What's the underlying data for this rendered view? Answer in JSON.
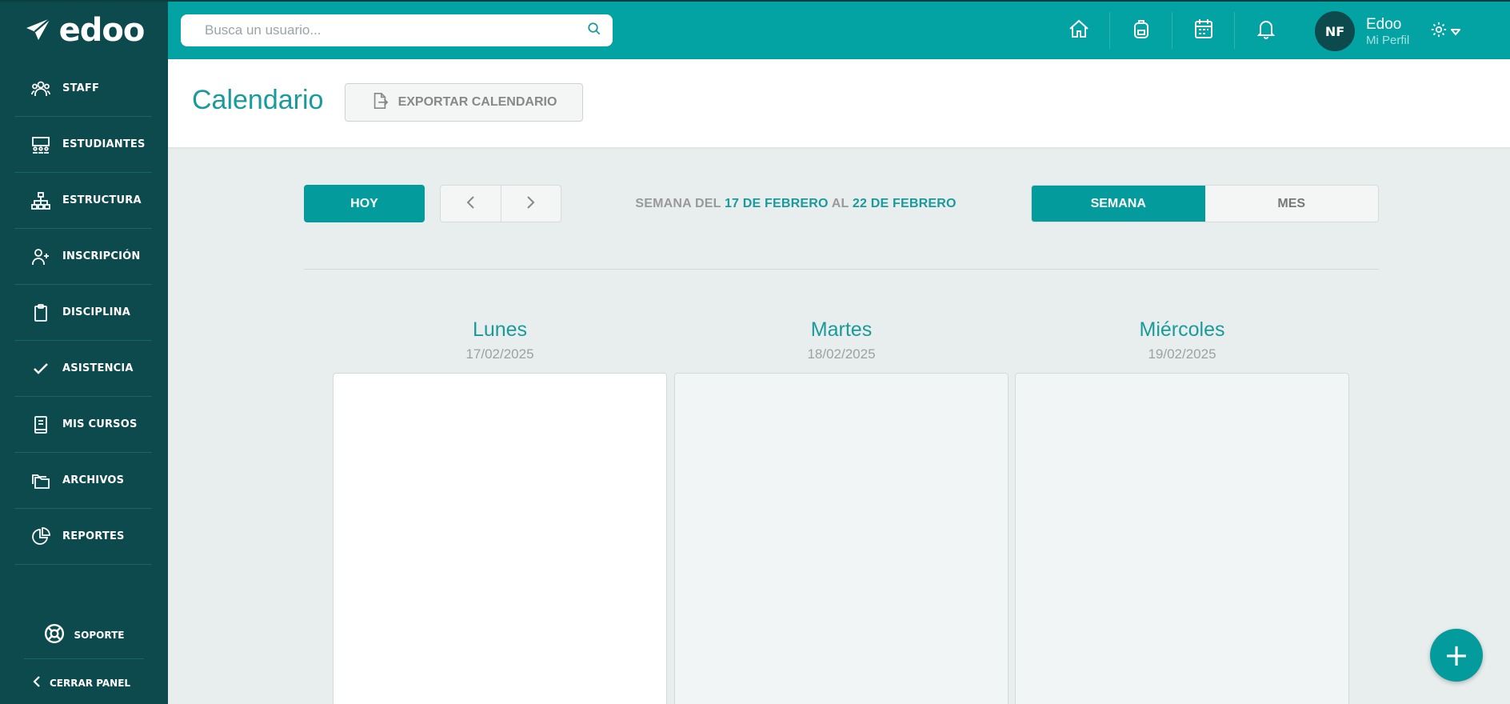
{
  "app": {
    "logo_text": "edoo"
  },
  "sidebar": {
    "items": [
      {
        "label": "STAFF",
        "icon": "users-icon"
      },
      {
        "label": "ESTUDIANTES",
        "icon": "classroom-icon"
      },
      {
        "label": "ESTRUCTURA",
        "icon": "hierarchy-icon"
      },
      {
        "label": "INSCRIPCIÓN",
        "icon": "user-plus-icon"
      },
      {
        "label": "DISCIPLINA",
        "icon": "clipboard-icon"
      },
      {
        "label": "ASISTENCIA",
        "icon": "check-icon"
      },
      {
        "label": "MIS CURSOS",
        "icon": "book-icon"
      },
      {
        "label": "ARCHIVOS",
        "icon": "folders-icon"
      },
      {
        "label": "REPORTES",
        "icon": "pie-chart-icon"
      }
    ],
    "support_label": "SOPORTE",
    "collapse_label": "CERRAR PANEL"
  },
  "topbar": {
    "search_placeholder": "Busca un usuario...",
    "icons": [
      "home-icon",
      "backpack-icon",
      "calendar-icon",
      "bell-icon"
    ],
    "user": {
      "initials": "NF",
      "name": "Edoo",
      "subtitle": "Mi Perfil"
    }
  },
  "page": {
    "title": "Calendario",
    "export_label": "EXPORTAR CALENDARIO"
  },
  "calendar": {
    "today_label": "HOY",
    "week_prefix": "SEMANA DEL",
    "week_start": "17 DE FEBRERO",
    "week_connector": "AL",
    "week_end": "22 DE FEBRERO",
    "views": {
      "week": "SEMANA",
      "month": "MES"
    },
    "active_view": "week",
    "days": [
      {
        "name": "Lunes",
        "date": "17/02/2025",
        "highlight": true
      },
      {
        "name": "Martes",
        "date": "18/02/2025",
        "highlight": false
      },
      {
        "name": "Miércoles",
        "date": "19/02/2025",
        "highlight": false
      }
    ]
  },
  "colors": {
    "primary": "#039b9c",
    "sidebar": "#0c4a4e",
    "topbar": "#03a2a3"
  },
  "fab_label": "+"
}
